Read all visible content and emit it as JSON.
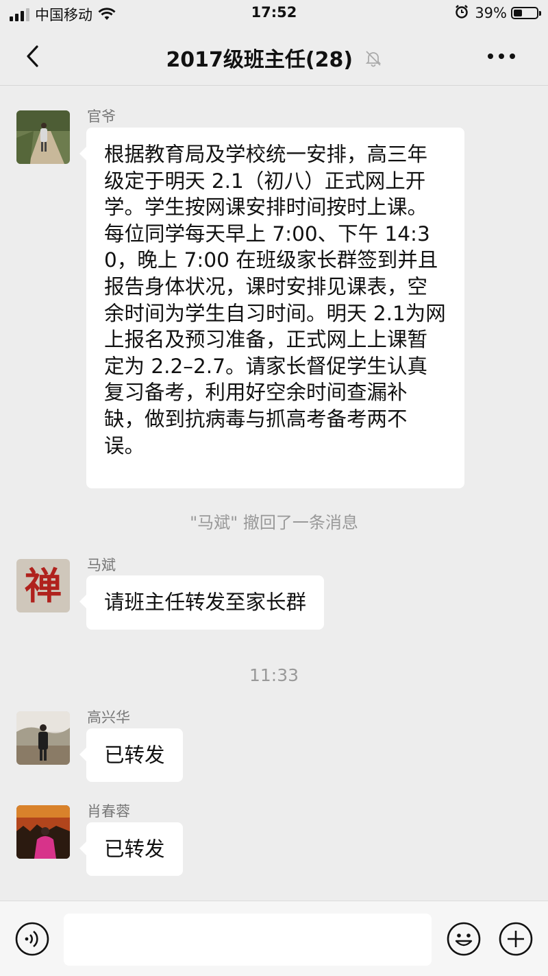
{
  "status_bar": {
    "carrier": "中国移动",
    "time": "17:52",
    "battery_percent": "39%",
    "battery_level": 0.39,
    "icons": [
      "signal-icon",
      "wifi-icon",
      "alarm-icon",
      "battery-icon"
    ]
  },
  "navbar": {
    "title": "2017级班主任(28)",
    "back_icon": "chevron-left-icon",
    "mute_icon": "muted-bell-icon",
    "more_icon": "more-dots-icon"
  },
  "messages": [
    {
      "sender": "官爷",
      "text": "根据教育局及学校统一安排，高三年级定于明天 2.1（初八）正式网上开学。学生按网课安排时间按时上课。每位同学每天早上 7:00、下午 14:30，晚上 7:00 在班级家长群签到并且报告身体状况，课时安排见课表，空余时间为学生自习时间。明天 2.1为网上报名及预习准备，正式网上上课暂定为 2.2–2.7。请家长督促学生认真复习备考，利用好空余时间查漏补缺，做到抗病毒与抓高考备考两不误。"
    },
    {
      "system": "\"马斌\" 撤回了一条消息"
    },
    {
      "sender": "马斌",
      "text": "请班主任转发至家长群"
    },
    {
      "system_time": "11:33"
    },
    {
      "sender": "高兴华",
      "text": "已转发"
    },
    {
      "sender": "肖春蓉",
      "text": "已转发"
    }
  ],
  "input_bar": {
    "voice_icon": "voice-icon",
    "emoji_icon": "emoji-icon",
    "plus_icon": "plus-icon",
    "placeholder": ""
  },
  "colors": {
    "background": "#ededed",
    "bubble": "#ffffff",
    "system_text": "#999999",
    "sender_text": "#777777"
  }
}
